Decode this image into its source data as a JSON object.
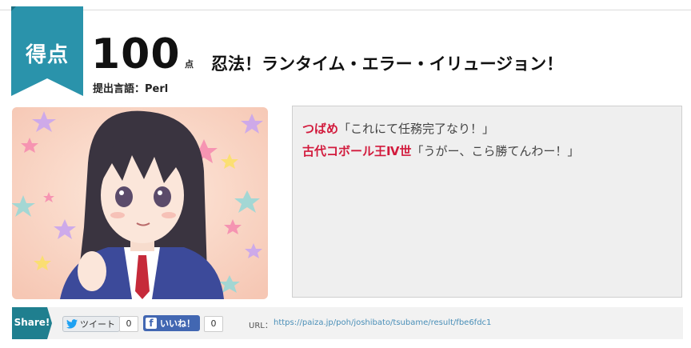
{
  "header": {
    "ribbon_label": "得点",
    "score": "100",
    "score_unit": "点",
    "result_title": "忍法！ランタイム・エラー・イリュージョン！",
    "language_line": "提出言語：Perl"
  },
  "portrait": {
    "alt": "character-illustration"
  },
  "dialogue": [
    {
      "speaker": "つばめ",
      "quote": "「これにて任務完了なり！」"
    },
    {
      "speaker": "古代コボール王Ⅳ世",
      "quote": "「うがー、こら勝てんわー！」"
    }
  ],
  "share": {
    "label": "Share!",
    "tweet_label": "ツイート",
    "tweet_count": "0",
    "like_label": "いいね！",
    "like_count": "0",
    "url_label": "URL：",
    "url": "https://paiza.jp/poh/joshibato/tsubame/result/fbe6fdc1"
  },
  "colors": {
    "ribbon": "#2a93ab",
    "share_tag": "#1f7f8f",
    "speaker": "#d21a3c",
    "facebook": "#4267b2",
    "link": "#4a8fb8"
  }
}
